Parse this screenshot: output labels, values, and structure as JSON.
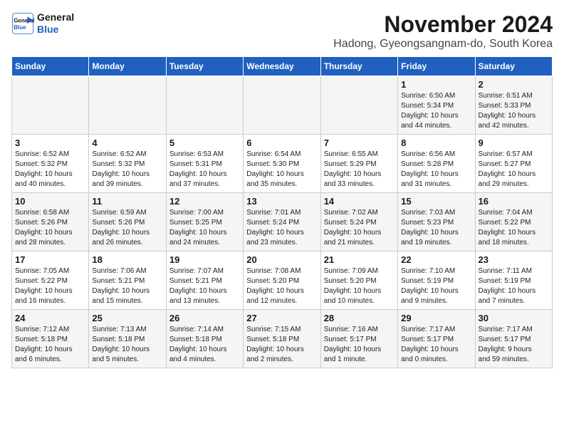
{
  "header": {
    "logo_line1": "General",
    "logo_line2": "Blue",
    "title": "November 2024",
    "subtitle": "Hadong, Gyeongsangnam-do, South Korea"
  },
  "weekdays": [
    "Sunday",
    "Monday",
    "Tuesday",
    "Wednesday",
    "Thursday",
    "Friday",
    "Saturday"
  ],
  "weeks": [
    [
      {
        "day": "",
        "info": ""
      },
      {
        "day": "",
        "info": ""
      },
      {
        "day": "",
        "info": ""
      },
      {
        "day": "",
        "info": ""
      },
      {
        "day": "",
        "info": ""
      },
      {
        "day": "1",
        "info": "Sunrise: 6:50 AM\nSunset: 5:34 PM\nDaylight: 10 hours\nand 44 minutes."
      },
      {
        "day": "2",
        "info": "Sunrise: 6:51 AM\nSunset: 5:33 PM\nDaylight: 10 hours\nand 42 minutes."
      }
    ],
    [
      {
        "day": "3",
        "info": "Sunrise: 6:52 AM\nSunset: 5:32 PM\nDaylight: 10 hours\nand 40 minutes."
      },
      {
        "day": "4",
        "info": "Sunrise: 6:52 AM\nSunset: 5:32 PM\nDaylight: 10 hours\nand 39 minutes."
      },
      {
        "day": "5",
        "info": "Sunrise: 6:53 AM\nSunset: 5:31 PM\nDaylight: 10 hours\nand 37 minutes."
      },
      {
        "day": "6",
        "info": "Sunrise: 6:54 AM\nSunset: 5:30 PM\nDaylight: 10 hours\nand 35 minutes."
      },
      {
        "day": "7",
        "info": "Sunrise: 6:55 AM\nSunset: 5:29 PM\nDaylight: 10 hours\nand 33 minutes."
      },
      {
        "day": "8",
        "info": "Sunrise: 6:56 AM\nSunset: 5:28 PM\nDaylight: 10 hours\nand 31 minutes."
      },
      {
        "day": "9",
        "info": "Sunrise: 6:57 AM\nSunset: 5:27 PM\nDaylight: 10 hours\nand 29 minutes."
      }
    ],
    [
      {
        "day": "10",
        "info": "Sunrise: 6:58 AM\nSunset: 5:26 PM\nDaylight: 10 hours\nand 28 minutes."
      },
      {
        "day": "11",
        "info": "Sunrise: 6:59 AM\nSunset: 5:26 PM\nDaylight: 10 hours\nand 26 minutes."
      },
      {
        "day": "12",
        "info": "Sunrise: 7:00 AM\nSunset: 5:25 PM\nDaylight: 10 hours\nand 24 minutes."
      },
      {
        "day": "13",
        "info": "Sunrise: 7:01 AM\nSunset: 5:24 PM\nDaylight: 10 hours\nand 23 minutes."
      },
      {
        "day": "14",
        "info": "Sunrise: 7:02 AM\nSunset: 5:24 PM\nDaylight: 10 hours\nand 21 minutes."
      },
      {
        "day": "15",
        "info": "Sunrise: 7:03 AM\nSunset: 5:23 PM\nDaylight: 10 hours\nand 19 minutes."
      },
      {
        "day": "16",
        "info": "Sunrise: 7:04 AM\nSunset: 5:22 PM\nDaylight: 10 hours\nand 18 minutes."
      }
    ],
    [
      {
        "day": "17",
        "info": "Sunrise: 7:05 AM\nSunset: 5:22 PM\nDaylight: 10 hours\nand 16 minutes."
      },
      {
        "day": "18",
        "info": "Sunrise: 7:06 AM\nSunset: 5:21 PM\nDaylight: 10 hours\nand 15 minutes."
      },
      {
        "day": "19",
        "info": "Sunrise: 7:07 AM\nSunset: 5:21 PM\nDaylight: 10 hours\nand 13 minutes."
      },
      {
        "day": "20",
        "info": "Sunrise: 7:08 AM\nSunset: 5:20 PM\nDaylight: 10 hours\nand 12 minutes."
      },
      {
        "day": "21",
        "info": "Sunrise: 7:09 AM\nSunset: 5:20 PM\nDaylight: 10 hours\nand 10 minutes."
      },
      {
        "day": "22",
        "info": "Sunrise: 7:10 AM\nSunset: 5:19 PM\nDaylight: 10 hours\nand 9 minutes."
      },
      {
        "day": "23",
        "info": "Sunrise: 7:11 AM\nSunset: 5:19 PM\nDaylight: 10 hours\nand 7 minutes."
      }
    ],
    [
      {
        "day": "24",
        "info": "Sunrise: 7:12 AM\nSunset: 5:18 PM\nDaylight: 10 hours\nand 6 minutes."
      },
      {
        "day": "25",
        "info": "Sunrise: 7:13 AM\nSunset: 5:18 PM\nDaylight: 10 hours\nand 5 minutes."
      },
      {
        "day": "26",
        "info": "Sunrise: 7:14 AM\nSunset: 5:18 PM\nDaylight: 10 hours\nand 4 minutes."
      },
      {
        "day": "27",
        "info": "Sunrise: 7:15 AM\nSunset: 5:18 PM\nDaylight: 10 hours\nand 2 minutes."
      },
      {
        "day": "28",
        "info": "Sunrise: 7:16 AM\nSunset: 5:17 PM\nDaylight: 10 hours\nand 1 minute."
      },
      {
        "day": "29",
        "info": "Sunrise: 7:17 AM\nSunset: 5:17 PM\nDaylight: 10 hours\nand 0 minutes."
      },
      {
        "day": "30",
        "info": "Sunrise: 7:17 AM\nSunset: 5:17 PM\nDaylight: 9 hours\nand 59 minutes."
      }
    ]
  ]
}
